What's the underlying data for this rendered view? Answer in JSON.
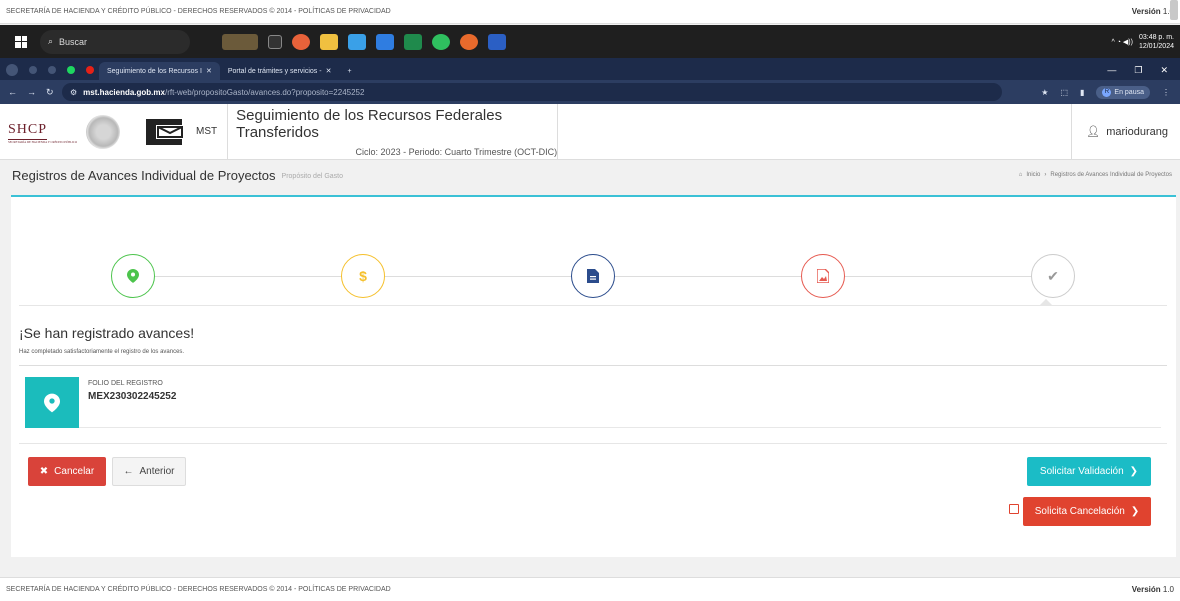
{
  "footer": {
    "text": "SECRETARÍA DE HACIENDA Y CRÉDITO PÚBLICO - DERECHOS RESERVADOS © 2014 - POLÍTICAS DE PRIVACIDAD",
    "version_label": "Versión",
    "version_number": "1.0"
  },
  "taskbar": {
    "search_placeholder": "Buscar",
    "time": "03:48 p. m.",
    "date": "12/01/2024"
  },
  "browser": {
    "tabs": [
      {
        "label": "Seguimiento de los Recursos I",
        "active": true
      },
      {
        "label": "Portal de trámites y servicios -",
        "active": false
      }
    ],
    "url_host": "mst.hacienda.gob.mx",
    "url_path": "/rft-web/propositoGasto/avances.do?proposito=2245252",
    "profile_status": "En pausa",
    "profile_initial": "R"
  },
  "header": {
    "brand": "SHCP",
    "brand_sub": "SECRETARÍA DE HACIENDA Y CRÉDITO PÚBLICO",
    "mst_label": "MST",
    "title": "Seguimiento de los Recursos Federales Transferidos",
    "cycle": "Ciclo: 2023 - Periodo: Cuarto Trimestre (OCT-DIC)",
    "user": "mariodurang"
  },
  "page": {
    "title": "Registros de Avances Individual de Proyectos",
    "subtitle": "Propósito del Gasto",
    "breadcrumb_home": "Inicio",
    "breadcrumb_current": "Registros de Avances Individual de Proyectos"
  },
  "wizard": {
    "steps": [
      {
        "icon": "map-marker-icon",
        "color": "#4cc44c"
      },
      {
        "icon": "dollar-icon",
        "color": "#f5c02c"
      },
      {
        "icon": "document-icon",
        "color": "#2b4c8c"
      },
      {
        "icon": "image-icon",
        "color": "#e65a50"
      },
      {
        "icon": "check-icon",
        "color": "#999999"
      }
    ]
  },
  "result": {
    "heading": "¡Se han registrado avances!",
    "message": "Haz completado satisfactoriamente el registro de los avances.",
    "folio_label": "FOLIO DEL REGISTRO",
    "folio_value": "MEX230302245252"
  },
  "actions": {
    "cancel": "Cancelar",
    "previous": "Anterior",
    "request_validation": "Solicitar Validación",
    "request_cancellation": "Solicita Cancelación"
  },
  "colors": {
    "accent": "#1bbcc6",
    "danger": "#d9433a"
  }
}
